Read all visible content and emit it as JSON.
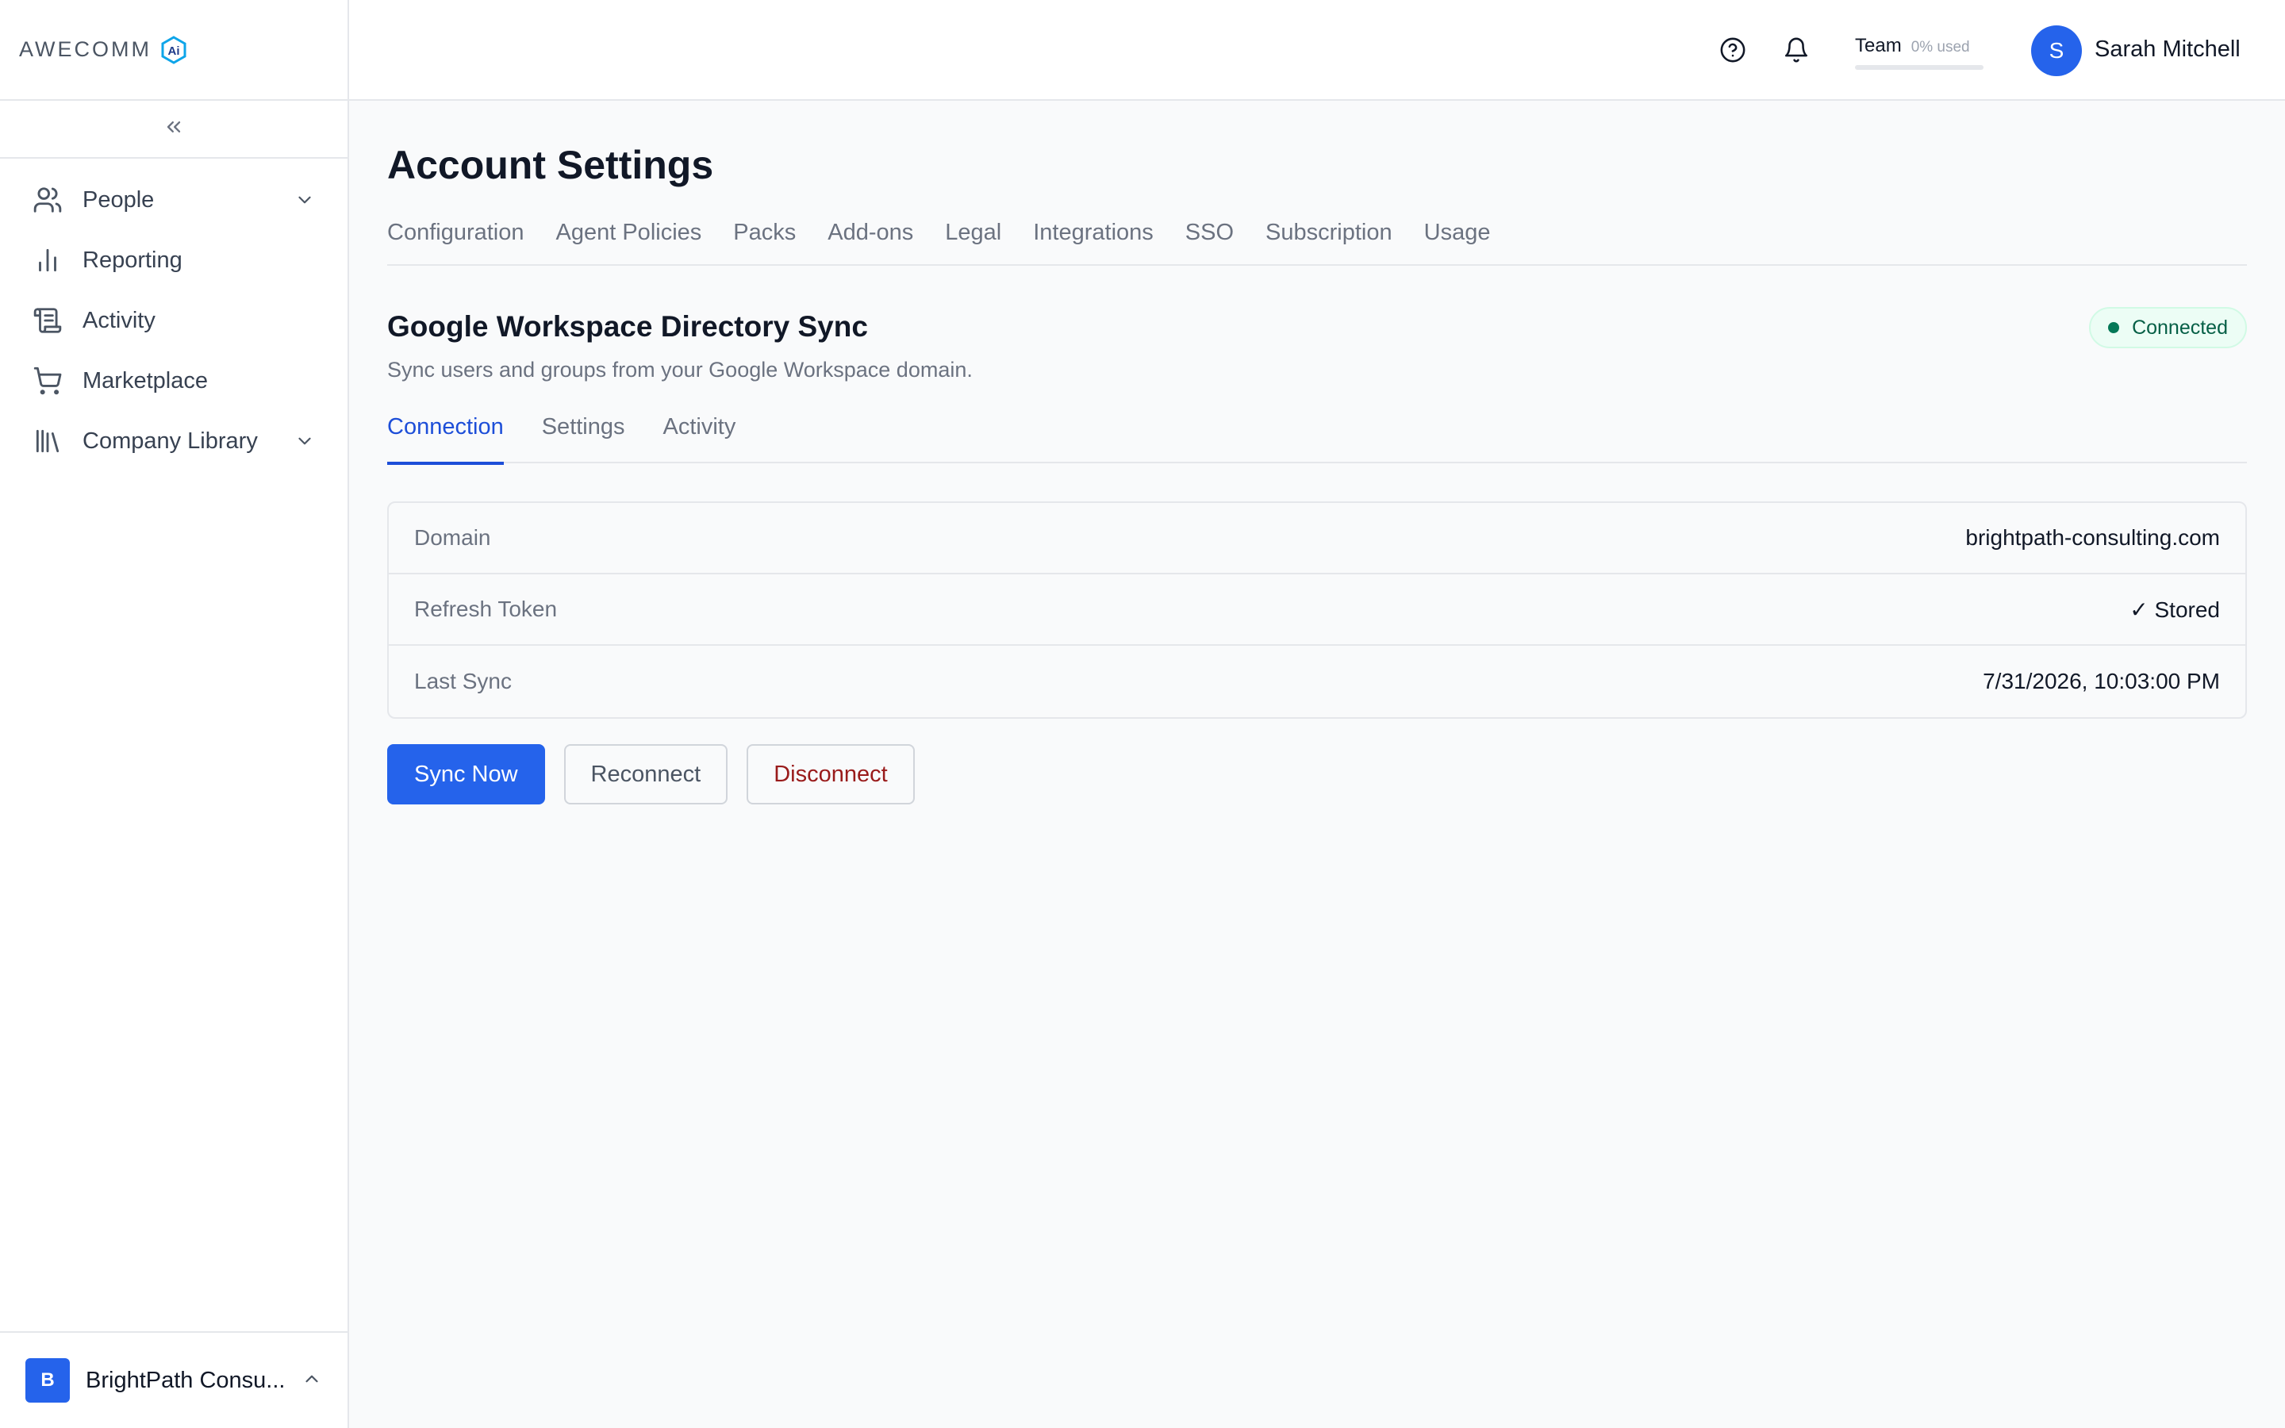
{
  "app": {
    "logo_text": "AWECOMM",
    "logo_badge": "Ai"
  },
  "sidebar": {
    "items": [
      {
        "label": "People",
        "icon": "users-icon",
        "has_chevron": true
      },
      {
        "label": "Reporting",
        "icon": "bar-chart-icon",
        "has_chevron": false
      },
      {
        "label": "Activity",
        "icon": "scroll-icon",
        "has_chevron": false
      },
      {
        "label": "Marketplace",
        "icon": "cart-icon",
        "has_chevron": false
      },
      {
        "label": "Company Library",
        "icon": "library-icon",
        "has_chevron": true
      }
    ],
    "org": {
      "initial": "B",
      "name": "BrightPath Consu..."
    }
  },
  "header": {
    "team_label": "Team",
    "team_used": "0% used",
    "team_used_fraction": 0,
    "user_initial": "S",
    "user_name": "Sarah Mitchell"
  },
  "page": {
    "title": "Account Settings",
    "tabs": [
      "Configuration",
      "Agent Policies",
      "Packs",
      "Add-ons",
      "Legal",
      "Integrations",
      "SSO",
      "Subscription",
      "Usage"
    ]
  },
  "integration": {
    "title": "Google Workspace Directory Sync",
    "description": "Sync users and groups from your Google Workspace domain.",
    "status": "Connected",
    "status_color": "#047857",
    "sub_tabs": [
      "Connection",
      "Settings",
      "Activity"
    ],
    "active_sub_tab": "Connection",
    "rows": [
      {
        "label": "Domain",
        "value": "brightpath-consulting.com"
      },
      {
        "label": "Refresh Token",
        "value": "✓ Stored"
      },
      {
        "label": "Last Sync",
        "value": "7/31/2026, 10:03:00 PM"
      }
    ],
    "buttons": {
      "sync": "Sync Now",
      "reconnect": "Reconnect",
      "disconnect": "Disconnect"
    }
  },
  "colors": {
    "accent": "#2563eb",
    "danger": "#991b1b"
  }
}
